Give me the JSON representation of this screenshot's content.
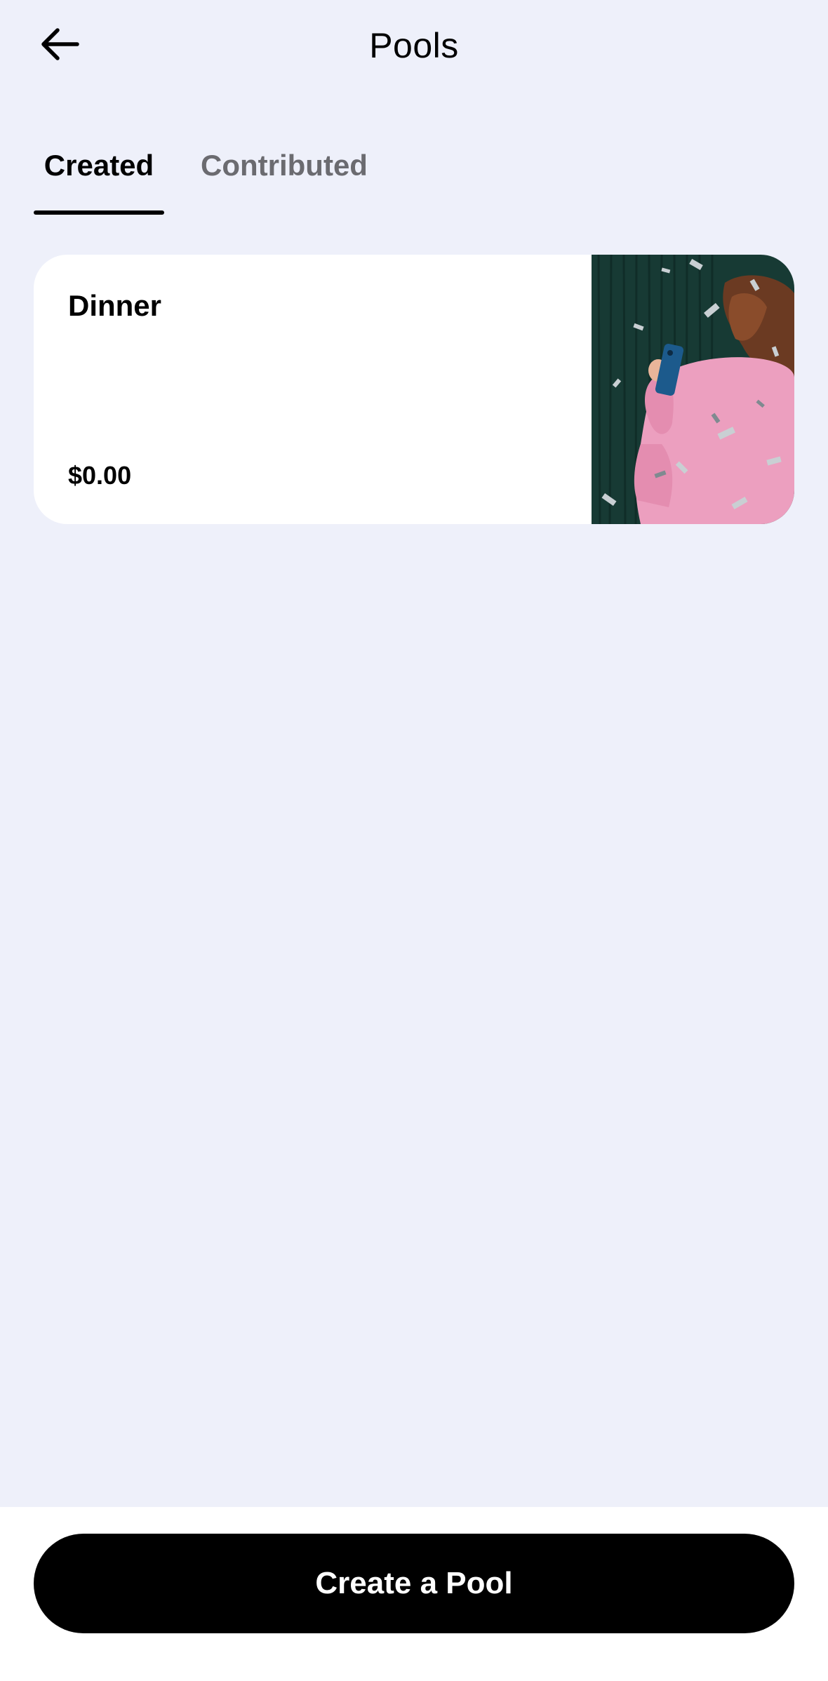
{
  "header": {
    "title": "Pools",
    "back_icon": "arrow-left-icon"
  },
  "tabs": [
    {
      "label": "Created",
      "active": true
    },
    {
      "label": "Contributed",
      "active": false
    }
  ],
  "pools": [
    {
      "name": "Dinner",
      "amount": "$0.00",
      "image_icon": "party-photo"
    }
  ],
  "footer": {
    "create_label": "Create a Pool"
  },
  "colors": {
    "background": "#eef0fa",
    "card": "#ffffff",
    "primary_button": "#000000",
    "active_tab": "#000000",
    "inactive_tab": "#6b6b70"
  }
}
